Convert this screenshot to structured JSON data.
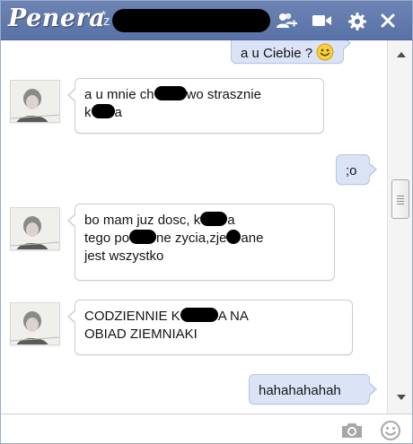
{
  "header": {
    "logo_text": "Penera",
    "logo_mark": "*",
    "title_prefix": "z",
    "title_name": "redacted",
    "icons": [
      "add-user-icon",
      "video-call-icon",
      "gear-icon",
      "close-icon"
    ]
  },
  "messages": [
    {
      "side": "out",
      "lines": [
        [
          {
            "t": "a u Ciebie ? "
          },
          {
            "icon": "smile-emoji"
          }
        ]
      ]
    },
    {
      "side": "in",
      "lines": [
        [
          {
            "t": "a u mnie ch"
          },
          {
            "censor": "redacted"
          },
          {
            "t": "wo strasznie"
          }
        ],
        [
          {
            "t": "k"
          },
          {
            "censor": "redacted"
          },
          {
            "t": "a"
          }
        ]
      ]
    },
    {
      "side": "out",
      "lines": [
        [
          {
            "t": ";o"
          }
        ]
      ]
    },
    {
      "side": "in",
      "lines": [
        [
          {
            "t": "bo mam juz dosc, k"
          },
          {
            "censor": "redacted"
          },
          {
            "t": "a"
          }
        ],
        [
          {
            "t": "tego po"
          },
          {
            "censor": "redacted"
          },
          {
            "t": "ne zycia,zje"
          },
          {
            "censor": "redacted"
          },
          {
            "t": "ane"
          }
        ],
        [
          {
            "t": "jest wszystko"
          }
        ]
      ]
    },
    {
      "side": "in",
      "lines": [
        [
          {
            "t": "CODZIENNIE K"
          },
          {
            "censor": "redacted"
          },
          {
            "t": "A NA"
          }
        ],
        [
          {
            "t": "OBIAD ZIEMNIAKI"
          }
        ]
      ]
    },
    {
      "side": "out",
      "lines": [
        [
          {
            "t": "hahahahahah"
          }
        ]
      ]
    }
  ],
  "input": {
    "value": "",
    "placeholder": ""
  },
  "colors": {
    "header_bg": "#627aad",
    "outgoing_bubble": "#dbe4f6",
    "incoming_bubble": "#ffffff",
    "emoji_yellow": "#f7cf3f"
  }
}
